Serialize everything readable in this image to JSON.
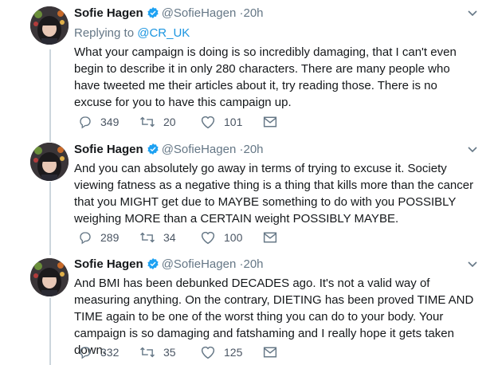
{
  "tweets": [
    {
      "name": "Sofie Hagen",
      "handle": "@SofieHagen",
      "separator": "·",
      "time": "20h",
      "replying_prefix": "Replying to",
      "replying_to": "@CR_UK",
      "text": "What your campaign is doing is so incredibly damaging, that I can't even begin to describe it in only 280 characters. There are many people who have tweeted me their articles about it, try reading those. There is no excuse for you to have this campaign up.",
      "replies": "349",
      "retweets": "20",
      "likes": "101"
    },
    {
      "name": "Sofie Hagen",
      "handle": "@SofieHagen",
      "separator": "·",
      "time": "20h",
      "text": "And you can absolutely go away in terms of trying to excuse it. Society viewing fatness as a negative thing is a thing that kills more than the cancer that you MIGHT get due to MAYBE something to do with you POSSIBLY weighing MORE than a CERTAIN weight POSSIBLY MAYBE.",
      "replies": "289",
      "retweets": "34",
      "likes": "100"
    },
    {
      "name": "Sofie Hagen",
      "handle": "@SofieHagen",
      "separator": "·",
      "time": "20h",
      "text": "And BMI has been debunked DECADES ago. It's not a valid way of measuring anything. On the contrary, DIETING has been proved TIME AND TIME again to be one of the worst thing you can do to your body. Your campaign is so damaging and fatshaming and I really hope it gets taken down.",
      "replies": "332",
      "retweets": "35",
      "likes": "125"
    }
  ],
  "icons": {
    "verified": "verified-badge-icon",
    "caret": "chevron-down-icon",
    "reply": "reply-icon",
    "retweet": "retweet-icon",
    "like": "heart-icon",
    "dm": "envelope-icon"
  },
  "colors": {
    "verified_blue": "#1da1f2",
    "mention_blue": "#1b95e0",
    "meta_gray": "#657786",
    "thread_line": "#ccd6dd"
  }
}
